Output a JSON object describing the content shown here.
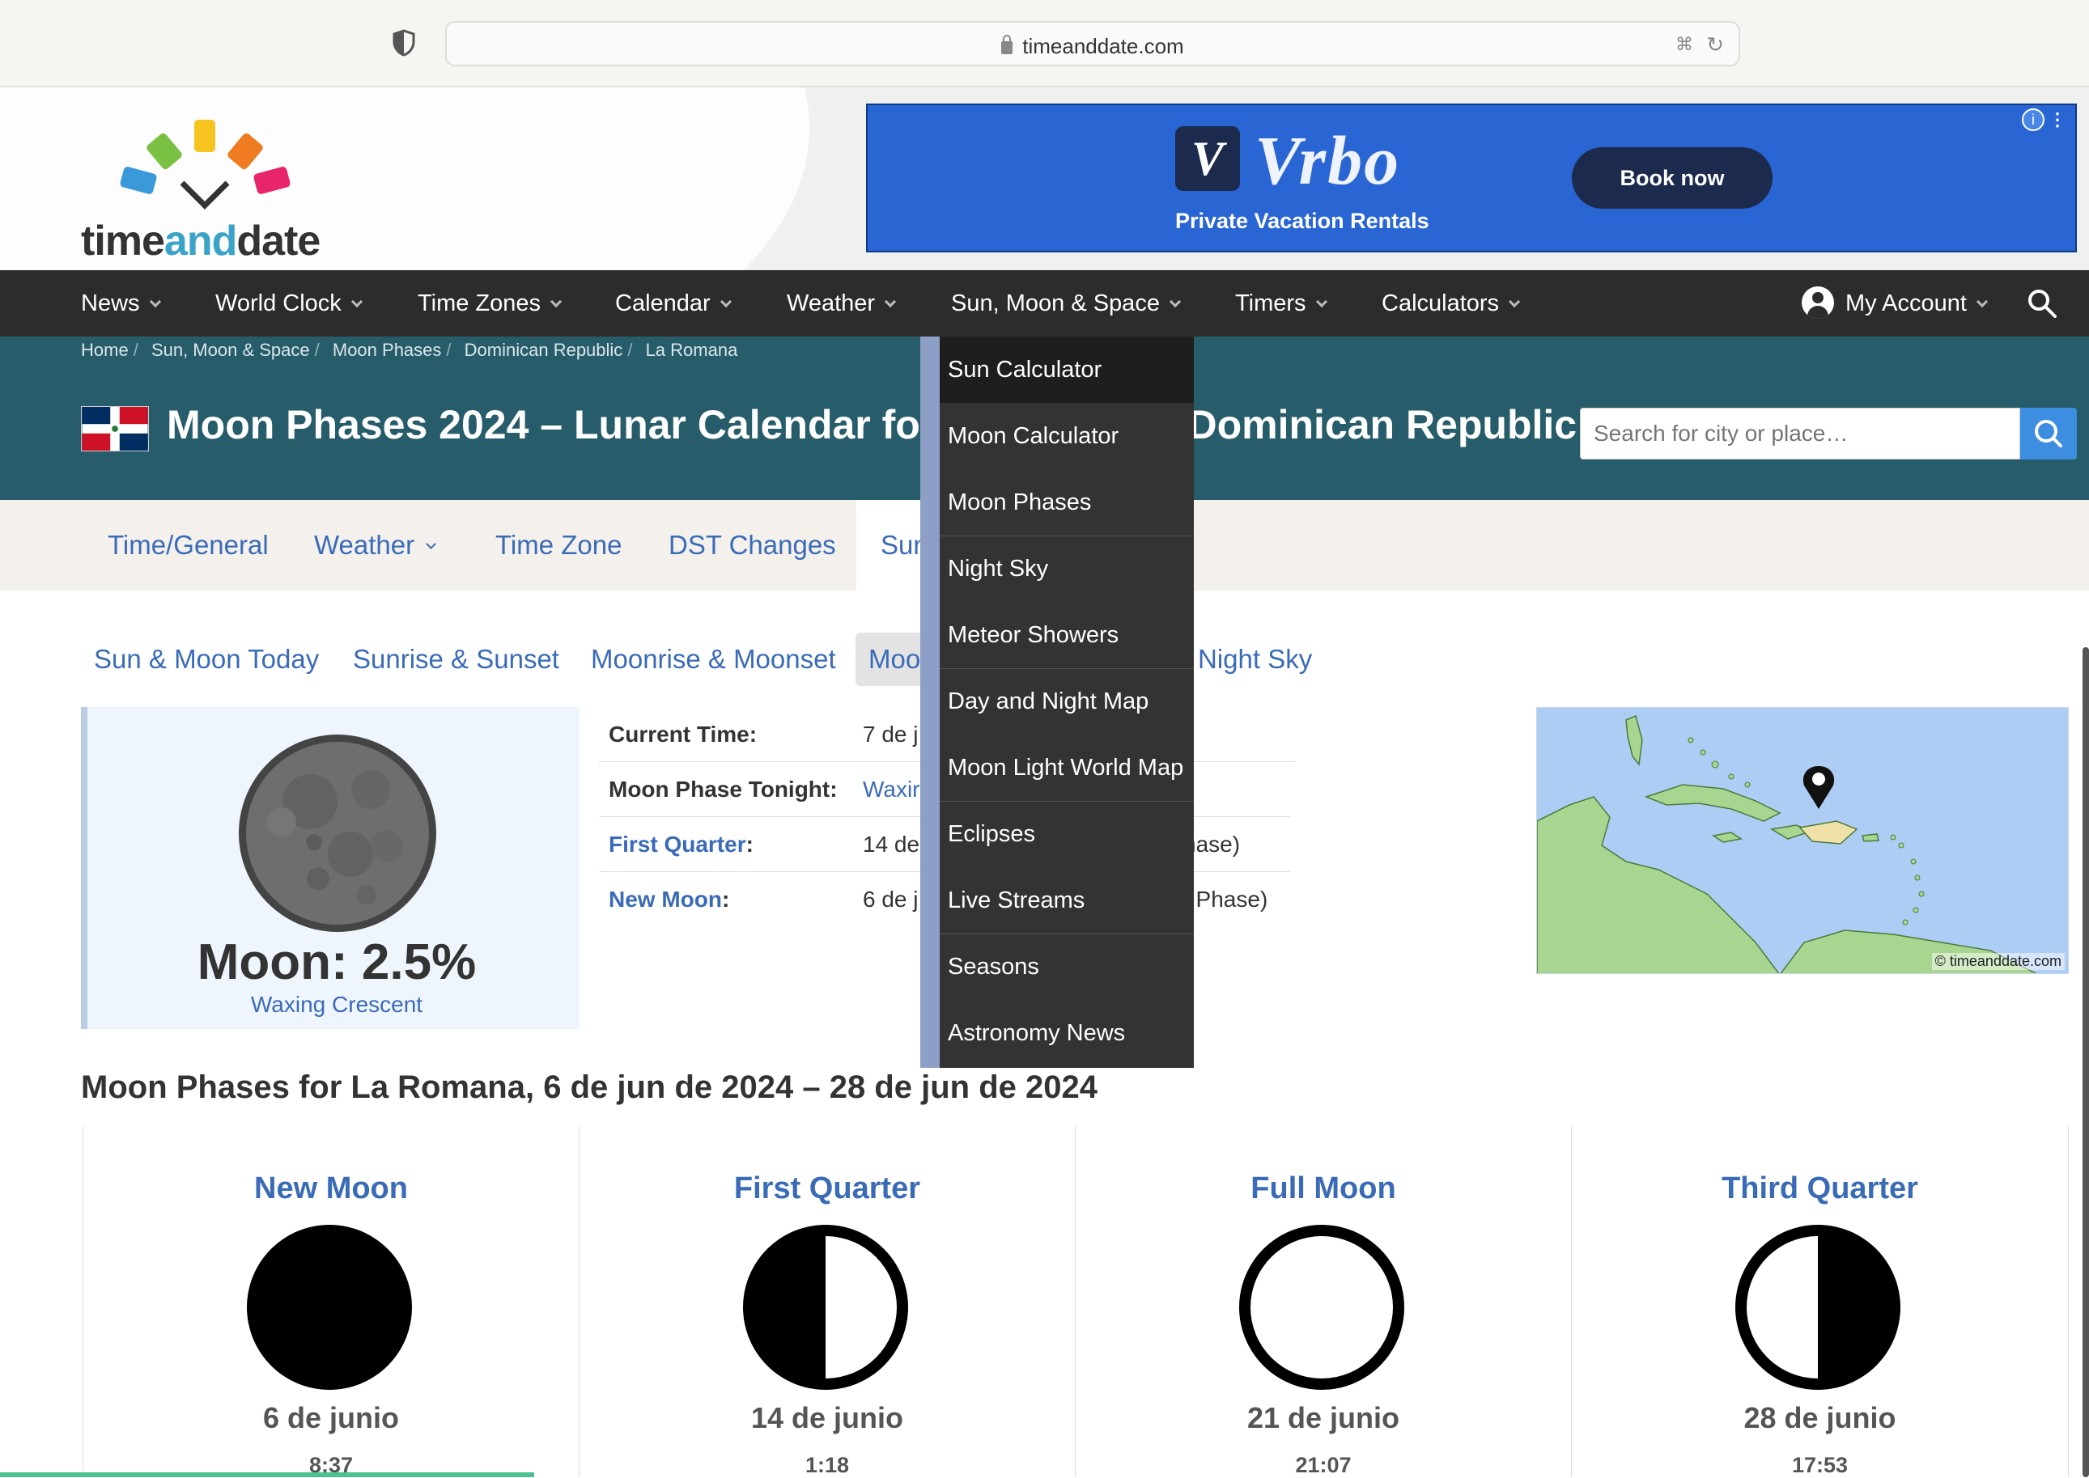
{
  "browser": {
    "url": "timeanddate.com"
  },
  "header": {
    "logo_text_a": "time",
    "logo_text_b": "and",
    "logo_text_c": "date",
    "ad": {
      "brand": "Vrbo",
      "tagline": "Private Vacation Rentals",
      "cta": "Book now"
    }
  },
  "nav": {
    "items": [
      "News",
      "World Clock",
      "Time Zones",
      "Calendar",
      "Weather",
      "Sun, Moon & Space",
      "Timers",
      "Calculators"
    ],
    "account": "My Account"
  },
  "breadcrumb": [
    "Home",
    "Sun, Moon & Space",
    "Moon Phases",
    "Dominican Republic",
    "La Romana"
  ],
  "title": "Moon Phases 2024 – Lunar Calendar for La Romana, Dominican Republic",
  "search": {
    "placeholder": "Search for city or place…"
  },
  "tabs": [
    "Time/General",
    "Weather",
    "Time Zone",
    "DST Changes",
    "Sun & Moon"
  ],
  "subtabs": [
    "Sun & Moon Today",
    "Sunrise & Sunset",
    "Moonrise & Moonset",
    "Moon Phases",
    "Night Sky"
  ],
  "moon": {
    "percent": "Moon: 2.5%",
    "phase": "Waxing Crescent"
  },
  "info": [
    {
      "label": "Current Time:",
      "value": "7 de j",
      "tail": ""
    },
    {
      "label": "Moon Phase Tonight:",
      "value": "Waxir",
      "tail": ""
    },
    {
      "label": "First Quarter",
      "value": "14 de",
      "tail": "hase)"
    },
    {
      "label": "New Moon",
      "value": "6 de j",
      "tail": "; Phase)"
    }
  ],
  "map": {
    "credit": "© timeanddate.com"
  },
  "phases_heading": "Moon Phases for La Romana, 6 de jun de 2024 – 28 de jun de 2024",
  "phases": [
    {
      "name": "New Moon",
      "date": "6 de junio",
      "time": "8:37"
    },
    {
      "name": "First Quarter",
      "date": "14 de junio",
      "time": "1:18"
    },
    {
      "name": "Full Moon",
      "date": "21 de junio",
      "time": "21:07"
    },
    {
      "name": "Third Quarter",
      "date": "28 de junio",
      "time": "17:53"
    }
  ],
  "dropdown": [
    "Sun Calculator",
    "Moon Calculator",
    "Moon Phases",
    "Night Sky",
    "Meteor Showers",
    "Day and Night Map",
    "Moon Light World Map",
    "Eclipses",
    "Live Streams",
    "Seasons",
    "Astronomy News"
  ],
  "colors": {
    "nav": "#2c2c2c",
    "titlebar": "#275c6a",
    "link": "#3a6bb7",
    "ad": "#2a66d3"
  }
}
